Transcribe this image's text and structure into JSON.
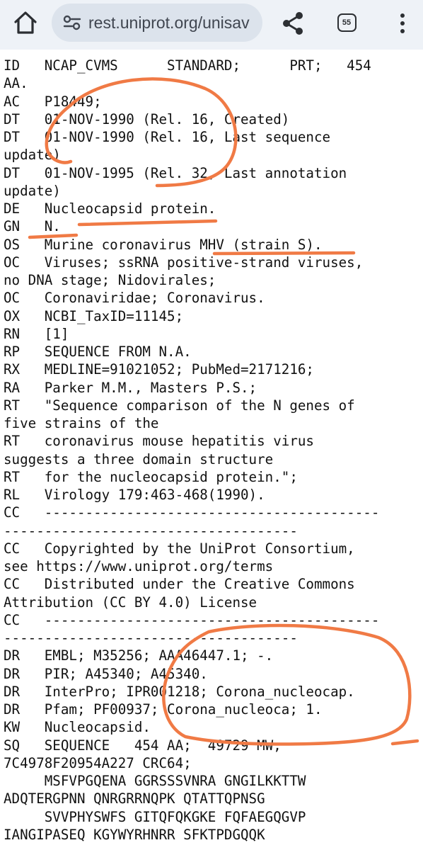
{
  "browser": {
    "url": "rest.uniprot.org/unisav",
    "tab_count": "55"
  },
  "entry_lines": [
    "ID   NCAP_CVMS      STANDARD;      PRT;   454",
    "AA.",
    "AC   P18449;",
    "DT   01-NOV-1990 (Rel. 16, Created)",
    "DT   01-NOV-1990 (Rel. 16, Last sequence",
    "update)",
    "DT   01-NOV-1995 (Rel. 32, Last annotation",
    "update)",
    "DE   Nucleocapsid protein.",
    "GN   N.",
    "OS   Murine coronavirus MHV (strain S).",
    "OC   Viruses; ssRNA positive-strand viruses,",
    "no DNA stage; Nidovirales;",
    "OC   Coronaviridae; Coronavirus.",
    "OX   NCBI_TaxID=11145;",
    "RN   [1]",
    "RP   SEQUENCE FROM N.A.",
    "RX   MEDLINE=91021052; PubMed=2171216;",
    "RA   Parker M.M., Masters P.S.;",
    "RT   \"Sequence comparison of the N genes of",
    "five strains of the",
    "RT   coronavirus mouse hepatitis virus",
    "suggests a three domain structure",
    "RT   for the nucleocapsid protein.\";",
    "RL   Virology 179:463-468(1990).",
    "CC   -----------------------------------------",
    "------------------------------------",
    "CC   Copyrighted by the UniProt Consortium,",
    "see https://www.uniprot.org/terms",
    "CC   Distributed under the Creative Commons",
    "Attribution (CC BY 4.0) License",
    "CC   -----------------------------------------",
    "------------------------------------",
    "DR   EMBL; M35256; AAA46447.1; -.",
    "DR   PIR; A45340; A45340.",
    "DR   InterPro; IPR001218; Corona_nucleocap.",
    "DR   Pfam; PF00937; Corona_nucleoca; 1.",
    "KW   Nucleocapsid.",
    "SQ   SEQUENCE   454 AA;  49729 MW;",
    "7C4978F20954A227 CRC64;",
    "     MSFVPGQENA GGRSSSVNRA GNGILKKTTW",
    "ADQTERGPNN QNRGRRNQPK QTATTQPNSG",
    "     SVVPHYSWFS GITQFQKGKE FQFAEGQGVP",
    "IANGIPASEQ KGYWYRHNRR SFKTPDGQQK"
  ],
  "annotation_color": "#f07a45"
}
